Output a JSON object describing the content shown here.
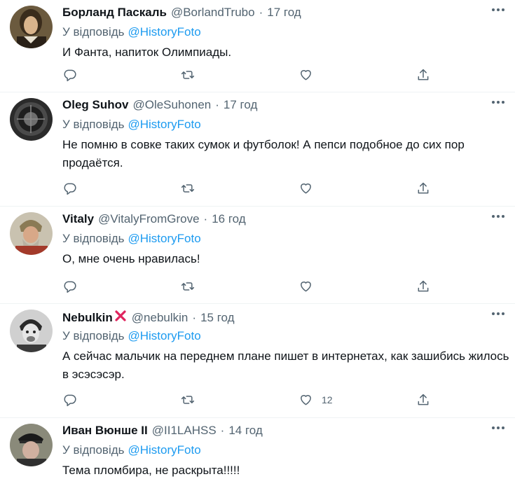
{
  "reply_prefix": "У відповідь",
  "tweets": [
    {
      "name": "Борланд Паскаль",
      "handle": "@BorlandTrubo",
      "time": "17 год",
      "mention": "@HistoryFoto",
      "text": "И Фанта, напиток Олимпиады.",
      "likes": ""
    },
    {
      "name": "Oleg Suhov",
      "handle": "@OleSuhonen",
      "time": "17 год",
      "mention": "@HistoryFoto",
      "text": "Не помню в совке таких сумок и футболок! А пепси подобное до сих пор продаётся.",
      "likes": ""
    },
    {
      "name": "Vitaly",
      "handle": "@VitalyFromGrove",
      "time": "16 год",
      "mention": "@HistoryFoto",
      "text": "О, мне очень нравилась!",
      "likes": ""
    },
    {
      "name": "Nebulkin",
      "handle": "@nebulkin",
      "time": "15 год",
      "mention": "@HistoryFoto",
      "text": "А сейчас мальчик на переднем плане пишет в интернетах, как зашибись жилось в эсэсэсэр.",
      "likes": "12"
    },
    {
      "name": "Иван Вюнше II",
      "handle": "@II1LAHSS",
      "time": "14 год",
      "mention": "@HistoryFoto",
      "text": "Тема пломбира, не раскрыта!!!!!",
      "likes": ""
    }
  ],
  "colors": {
    "link": "#1d9bf0",
    "secondary": "#536471",
    "text": "#0f1419",
    "divider": "#eff3f4",
    "name_badge": "#e0245e"
  }
}
